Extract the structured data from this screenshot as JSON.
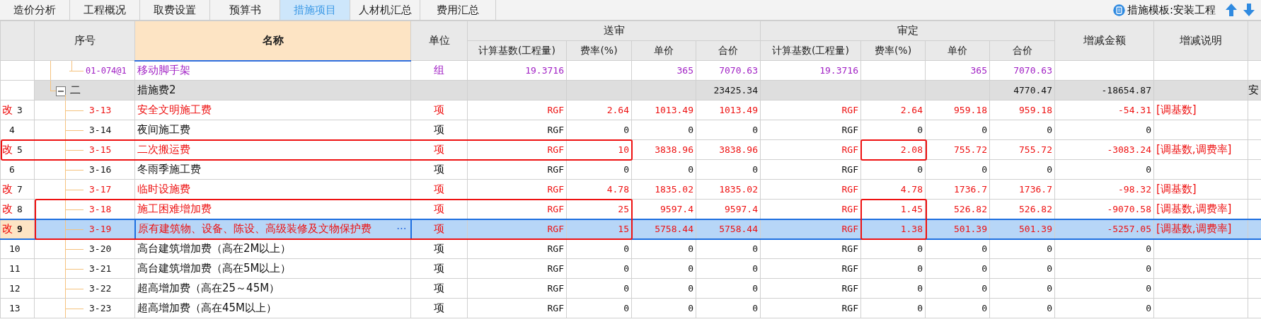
{
  "tabs": [
    {
      "label": "造价分析",
      "selected": false
    },
    {
      "label": "工程概况",
      "selected": false
    },
    {
      "label": "取费设置",
      "selected": false
    },
    {
      "label": "预算书",
      "selected": false
    },
    {
      "label": "措施项目",
      "selected": true
    },
    {
      "label": "人材机汇总",
      "selected": false
    },
    {
      "label": "费用汇总",
      "selected": false
    }
  ],
  "template": {
    "label": "措施模板:安装工程"
  },
  "table": {
    "columns": [
      "序号",
      "名称",
      "单位"
    ],
    "groups": [
      {
        "label": "送审",
        "columns": [
          "计算基数(工程量)",
          "费率(%)",
          "单价",
          "合价"
        ]
      },
      {
        "label": "审定",
        "columns": [
          "计算基数(工程量)",
          "费率(%)",
          "单价",
          "合价"
        ]
      }
    ],
    "after_columns": [
      "增减金额",
      "增减说明"
    ],
    "rows": [
      {
        "kind": "quota",
        "changed": false,
        "selected": false,
        "code": "01-074@1",
        "name": "移动脚手架",
        "unit": "组",
        "submitted": {
          "base": "19.3716",
          "price": "365",
          "total": "7070.63"
        },
        "approved": {
          "base": "19.3716",
          "price": "365",
          "total": "7070.63"
        }
      },
      {
        "kind": "group",
        "changed": false,
        "selected": false,
        "expanded": true,
        "code": "二",
        "name": "措施费2",
        "submitted": {
          "total": "23425.34"
        },
        "approved": {
          "total": "4770.47"
        },
        "diff": "-18654.87",
        "extra": "安",
        "children": [
          {
            "kind": "measure",
            "mark": "改",
            "number": "3",
            "changed": true,
            "selected": false,
            "code": "3-13",
            "name": "安全文明施工费",
            "unit": "项",
            "submitted": {
              "base": "RGF",
              "rate": "2.64",
              "price": "1013.49",
              "total": "1013.49"
            },
            "approved": {
              "base": "RGF",
              "rate": "2.64",
              "price": "959.18",
              "total": "959.18"
            },
            "diff": "-54.31",
            "note": "[调基数]"
          },
          {
            "kind": "measure",
            "number": "4",
            "changed": false,
            "selected": false,
            "code": "3-14",
            "name": "夜间施工费",
            "unit": "项",
            "submitted": {
              "base": "RGF",
              "rate": "0",
              "price": "0",
              "total": "0"
            },
            "approved": {
              "base": "RGF",
              "rate": "0",
              "price": "0",
              "total": "0"
            },
            "diff": "0"
          },
          {
            "kind": "measure",
            "mark": "改",
            "number": "5",
            "changed": true,
            "selected": false,
            "boxed": true,
            "code": "3-15",
            "name": "二次搬运费",
            "unit": "项",
            "submitted": {
              "base": "RGF",
              "rate": "10",
              "price": "3838.96",
              "total": "3838.96"
            },
            "approved": {
              "base": "RGF",
              "rate": "2.08",
              "price": "755.72",
              "total": "755.72"
            },
            "diff": "-3083.24",
            "note": "[调基数,调费率]"
          },
          {
            "kind": "measure",
            "number": "6",
            "changed": false,
            "selected": false,
            "code": "3-16",
            "name": "冬雨季施工费",
            "unit": "项",
            "submitted": {
              "base": "RGF",
              "rate": "0",
              "price": "0",
              "total": "0"
            },
            "approved": {
              "base": "RGF",
              "rate": "0",
              "price": "0",
              "total": "0"
            },
            "diff": "0"
          },
          {
            "kind": "measure",
            "mark": "改",
            "number": "7",
            "changed": true,
            "selected": false,
            "code": "3-17",
            "name": "临时设施费",
            "unit": "项",
            "submitted": {
              "base": "RGF",
              "rate": "4.78",
              "price": "1835.02",
              "total": "1835.02"
            },
            "approved": {
              "base": "RGF",
              "rate": "4.78",
              "price": "1736.7",
              "total": "1736.7"
            },
            "diff": "-98.32",
            "note": "[调基数]"
          },
          {
            "kind": "measure",
            "mark": "改",
            "number": "8",
            "changed": true,
            "selected": false,
            "boxed": true,
            "code": "3-18",
            "name": "施工困难增加费",
            "unit": "项",
            "submitted": {
              "base": "RGF",
              "rate": "25",
              "price": "9597.4",
              "total": "9597.4"
            },
            "approved": {
              "base": "RGF",
              "rate": "1.45",
              "price": "526.82",
              "total": "526.82"
            },
            "diff": "-9070.58",
            "note": "[调基数,调费率]"
          },
          {
            "kind": "measure",
            "mark": "改",
            "number": "9",
            "changed": true,
            "selected": true,
            "boxed": true,
            "code": "3-19",
            "name": "原有建筑物、设备、陈设、高级装修及文物保护费",
            "edit_button": "···",
            "unit": "项",
            "submitted": {
              "base": "RGF",
              "rate": "15",
              "price": "5758.44",
              "total": "5758.44"
            },
            "approved": {
              "base": "RGF",
              "rate": "1.38",
              "price": "501.39",
              "total": "501.39"
            },
            "diff": "-5257.05",
            "note": "[调基数,调费率]"
          },
          {
            "kind": "measure",
            "number": "10",
            "changed": false,
            "selected": false,
            "code": "3-20",
            "name": "高台建筑增加费（高在2M以上）",
            "unit": "项",
            "submitted": {
              "base": "RGF",
              "rate": "0",
              "price": "0",
              "total": "0"
            },
            "approved": {
              "base": "RGF",
              "rate": "0",
              "price": "0",
              "total": "0"
            },
            "diff": "0"
          },
          {
            "kind": "measure",
            "number": "11",
            "changed": false,
            "selected": false,
            "code": "3-21",
            "name": "高台建筑增加费（高在5M以上）",
            "unit": "项",
            "submitted": {
              "base": "RGF",
              "rate": "0",
              "price": "0",
              "total": "0"
            },
            "approved": {
              "base": "RGF",
              "rate": "0",
              "price": "0",
              "total": "0"
            },
            "diff": "0"
          },
          {
            "kind": "measure",
            "number": "12",
            "changed": false,
            "selected": false,
            "code": "3-22",
            "name": "超高增加费（高在25～45M）",
            "unit": "项",
            "submitted": {
              "base": "RGF",
              "rate": "0",
              "price": "0",
              "total": "0"
            },
            "approved": {
              "base": "RGF",
              "rate": "0",
              "price": "0",
              "total": "0"
            },
            "diff": "0"
          },
          {
            "kind": "measure",
            "number": "13",
            "changed": false,
            "selected": false,
            "code": "3-23",
            "name": "超高增加费（高在45M以上）",
            "unit": "项",
            "submitted": {
              "base": "RGF",
              "rate": "0",
              "price": "0",
              "total": "0"
            },
            "approved": {
              "base": "RGF",
              "rate": "0",
              "price": "0",
              "total": "0"
            },
            "diff": "0"
          }
        ]
      }
    ]
  }
}
